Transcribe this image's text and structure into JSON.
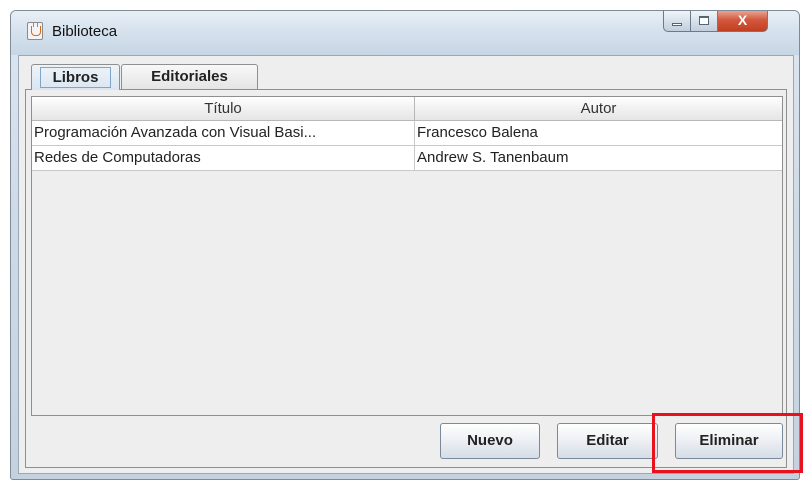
{
  "window": {
    "title": "Biblioteca",
    "controls": {
      "minimize_icon": "minimize-icon",
      "maximize_icon": "maximize-icon",
      "close_glyph": "X"
    }
  },
  "tabs": [
    {
      "label": "Libros",
      "selected": true
    },
    {
      "label": "Editoriales",
      "selected": false
    }
  ],
  "table": {
    "columns": [
      "Título",
      "Autor"
    ],
    "rows": [
      [
        "Programación Avanzada con Visual Basi...",
        "Francesco Balena"
      ],
      [
        "Redes de Computadoras",
        "Andrew S. Tanenbaum"
      ]
    ]
  },
  "buttons": {
    "nuevo": "Nuevo",
    "editar": "Editar",
    "eliminar": "Eliminar"
  },
  "colors": {
    "highlight": "#e8121c",
    "close_button": "#c94a2e",
    "titlebar": "#d6e2ee"
  }
}
